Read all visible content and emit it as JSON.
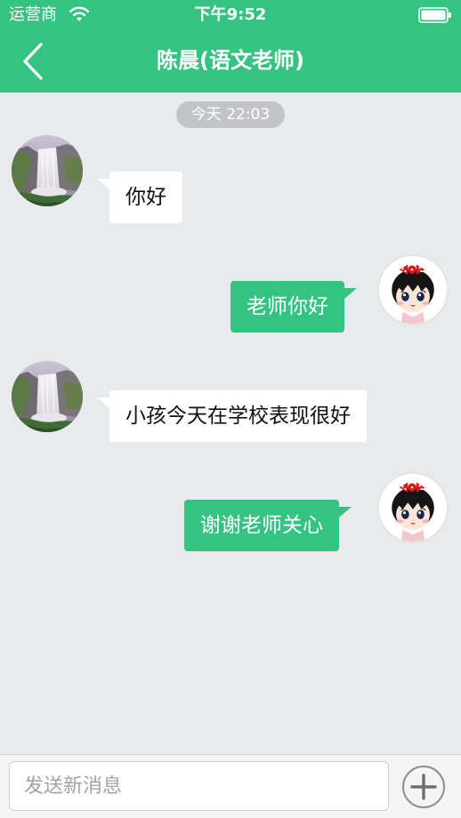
{
  "status_bar": {
    "carrier": "运营商",
    "time": "下午9:52",
    "wifi_icon": "wifi-icon",
    "battery_icon": "battery-icon"
  },
  "nav": {
    "back_icon": "chevron-left-icon",
    "title": "陈晨(语文老师)"
  },
  "chat": {
    "timestamp": "今天 22:03",
    "messages": [
      {
        "direction": "incoming",
        "avatar": "waterfall-photo",
        "text": "你好"
      },
      {
        "direction": "outgoing",
        "avatar": "cartoon-girl",
        "text": "老师你好"
      },
      {
        "direction": "incoming",
        "avatar": "waterfall-photo",
        "text": "小孩今天在学校表现很好"
      },
      {
        "direction": "outgoing",
        "avatar": "cartoon-girl",
        "text": "谢谢老师关心"
      }
    ]
  },
  "composer": {
    "placeholder": "发送新消息",
    "value": "",
    "add_icon": "plus-icon"
  },
  "colors": {
    "brand_green": "#35c382",
    "chat_background": "#e9eaec",
    "incoming_bubble": "#ffffff",
    "outgoing_bubble": "#35c382",
    "timestamp_pill": "#c2c4c7"
  }
}
